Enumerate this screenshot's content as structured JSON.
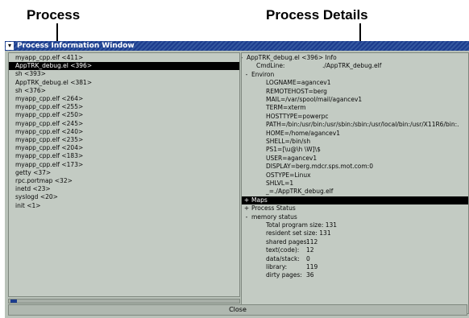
{
  "callouts": {
    "process": "Process",
    "process_details": "Process Details"
  },
  "window": {
    "title": "Process Information Window",
    "close_label": "Close"
  },
  "process_list": [
    "myapp_cpp.elf <411>",
    "AppTRK_debug.el <396>",
    "sh <393>",
    "AppTRK_debug.el <381>",
    "sh <376>",
    "myapp_cpp.elf <264>",
    "myapp_cpp.elf <255>",
    "myapp_cpp.elf <250>",
    "myapp_cpp.elf <245>",
    "myapp_cpp.elf <240>",
    "myapp_cpp.elf <235>",
    "myapp_cpp.elf <204>",
    "myapp_cpp.elf <183>",
    "myapp_cpp.elf <173>",
    "getty <37>",
    "rpc.portmap <32>",
    "inetd <23>",
    "syslogd <20>",
    "init <1>"
  ],
  "selected_process_index": 1,
  "details_tree": [
    {
      "toggle": "-",
      "label": "AppTRK_debug.el <396>  Info",
      "level": 0
    },
    {
      "toggle": "",
      "label": "CmdLine:",
      "value": "./AppTRK_debug.elf",
      "level": 1
    },
    {
      "toggle": "-",
      "label": "Environ",
      "level": 0.5
    },
    {
      "toggle": "",
      "label": "LOGNAME=agancev1",
      "level": 2
    },
    {
      "toggle": "",
      "label": "REMOTEHOST=berg",
      "level": 2
    },
    {
      "toggle": "",
      "label": "MAIL=/var/spool/mail/agancev1",
      "level": 2
    },
    {
      "toggle": "",
      "label": "TERM=xterm",
      "level": 2
    },
    {
      "toggle": "",
      "label": "HOSTTYPE=powerpc",
      "level": 2
    },
    {
      "toggle": "",
      "label": "PATH=/bin:/usr/bin:/usr/sbin:/sbin:/usr/local/bin:/usr/X11R6/bin:.",
      "level": 2
    },
    {
      "toggle": "",
      "label": "HOME=/home/agancev1",
      "level": 2
    },
    {
      "toggle": "",
      "label": "SHELL=/bin/sh",
      "level": 2
    },
    {
      "toggle": "",
      "label": "PS1=[\\u@\\h \\W]\\$",
      "level": 2
    },
    {
      "toggle": "",
      "label": "USER=agancev1",
      "level": 2
    },
    {
      "toggle": "",
      "label": "DISPLAY=berg.mdcr.sps.mot.com:0",
      "level": 2
    },
    {
      "toggle": "",
      "label": "OSTYPE=Linux",
      "level": 2
    },
    {
      "toggle": "",
      "label": "SHLVL=1",
      "level": 2
    },
    {
      "toggle": "",
      "label": "_=./AppTRK_debug.elf",
      "level": 2
    },
    {
      "toggle": "+",
      "label": "Maps",
      "level": 0.5,
      "selected": true
    },
    {
      "toggle": "+",
      "label": "Process Status",
      "level": 0.5
    },
    {
      "toggle": "-",
      "label": "memory status",
      "level": 0.5
    },
    {
      "toggle": "",
      "label": "Total program size: 131",
      "level": 2
    },
    {
      "toggle": "",
      "label": "resident set size:  131",
      "level": 2
    },
    {
      "toggle": "",
      "label": "shared pages:",
      "value": "112",
      "level": 2
    },
    {
      "toggle": "",
      "label": "text(code):",
      "value": "12",
      "level": 2
    },
    {
      "toggle": "",
      "label": "data/stack:",
      "value": "0",
      "level": 2
    },
    {
      "toggle": "",
      "label": "library:",
      "value": "119",
      "level": 2
    },
    {
      "toggle": "",
      "label": "dirty pages:",
      "value": "36",
      "level": 2
    }
  ]
}
